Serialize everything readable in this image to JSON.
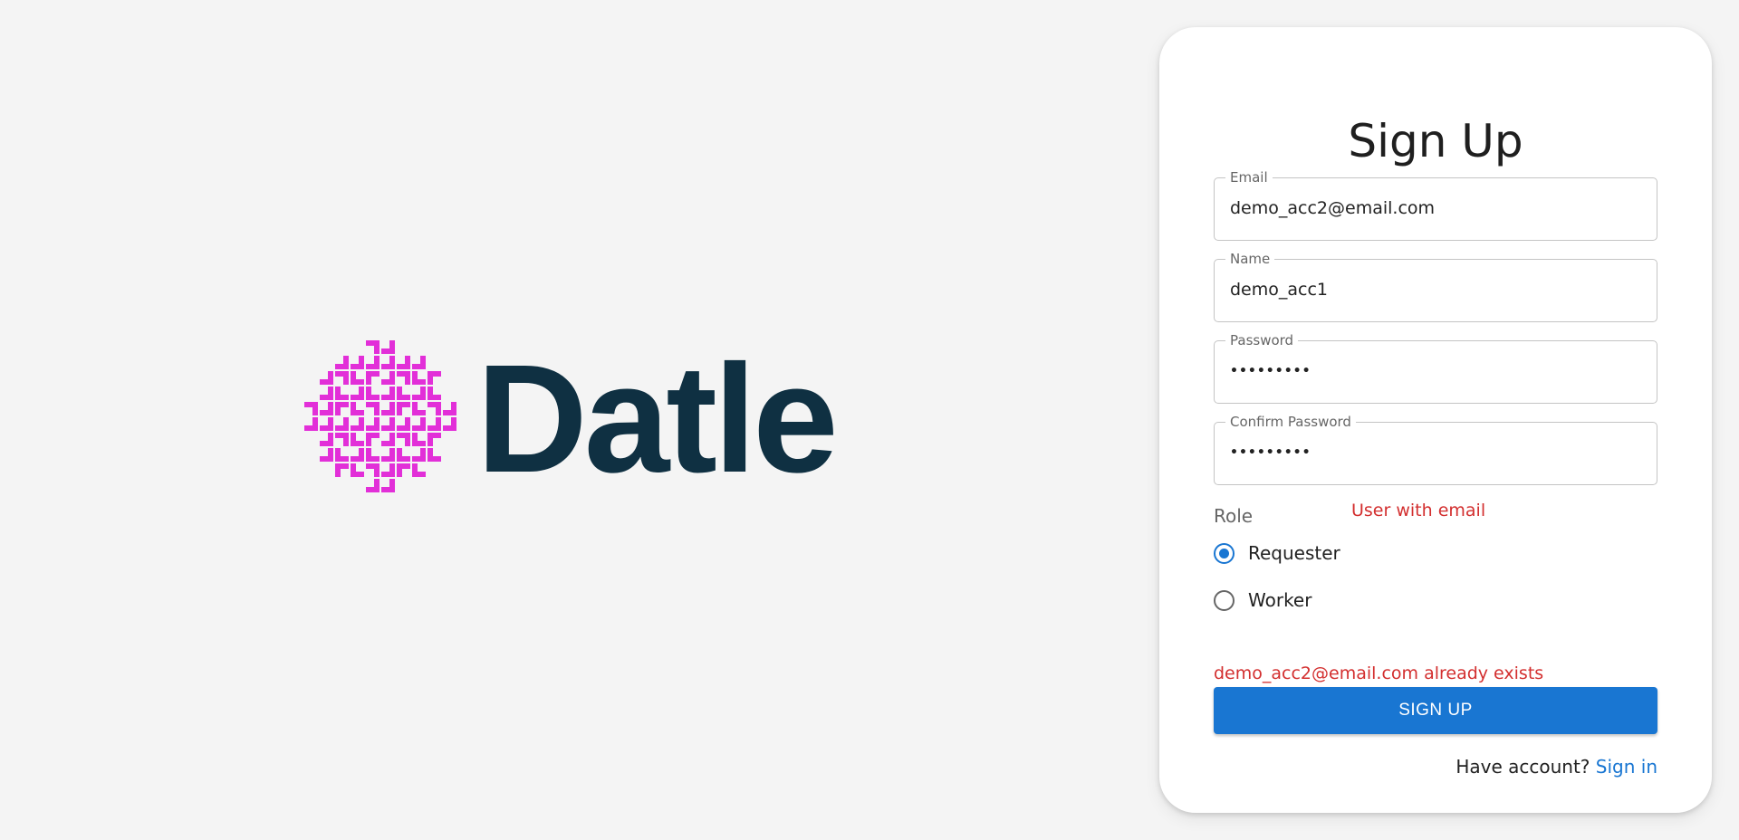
{
  "brand": {
    "name": "Datle",
    "icon": "datle-logo-mark",
    "icon_color": "#e22fd8",
    "text_color": "#0f3042"
  },
  "form": {
    "title": "Sign Up",
    "fields": {
      "email": {
        "label": "Email",
        "value": "demo_acc2@email.com"
      },
      "name": {
        "label": "Name",
        "value": "demo_acc1"
      },
      "password": {
        "label": "Password",
        "value": "•••••••••"
      },
      "confirm_password": {
        "label": "Confirm Password",
        "value": "•••••••••"
      }
    },
    "role": {
      "label": "Role",
      "options": [
        {
          "label": "Requester",
          "selected": true
        },
        {
          "label": "Worker",
          "selected": false
        }
      ]
    },
    "inline_error": "User with email",
    "error": "demo_acc2@email.com already exists",
    "submit_label": "SIGN UP",
    "footer": {
      "prompt": "Have account?",
      "link": "Sign in"
    }
  },
  "colors": {
    "primary": "#1976d2",
    "error": "#d32f2f",
    "background": "#f4f4f4"
  }
}
